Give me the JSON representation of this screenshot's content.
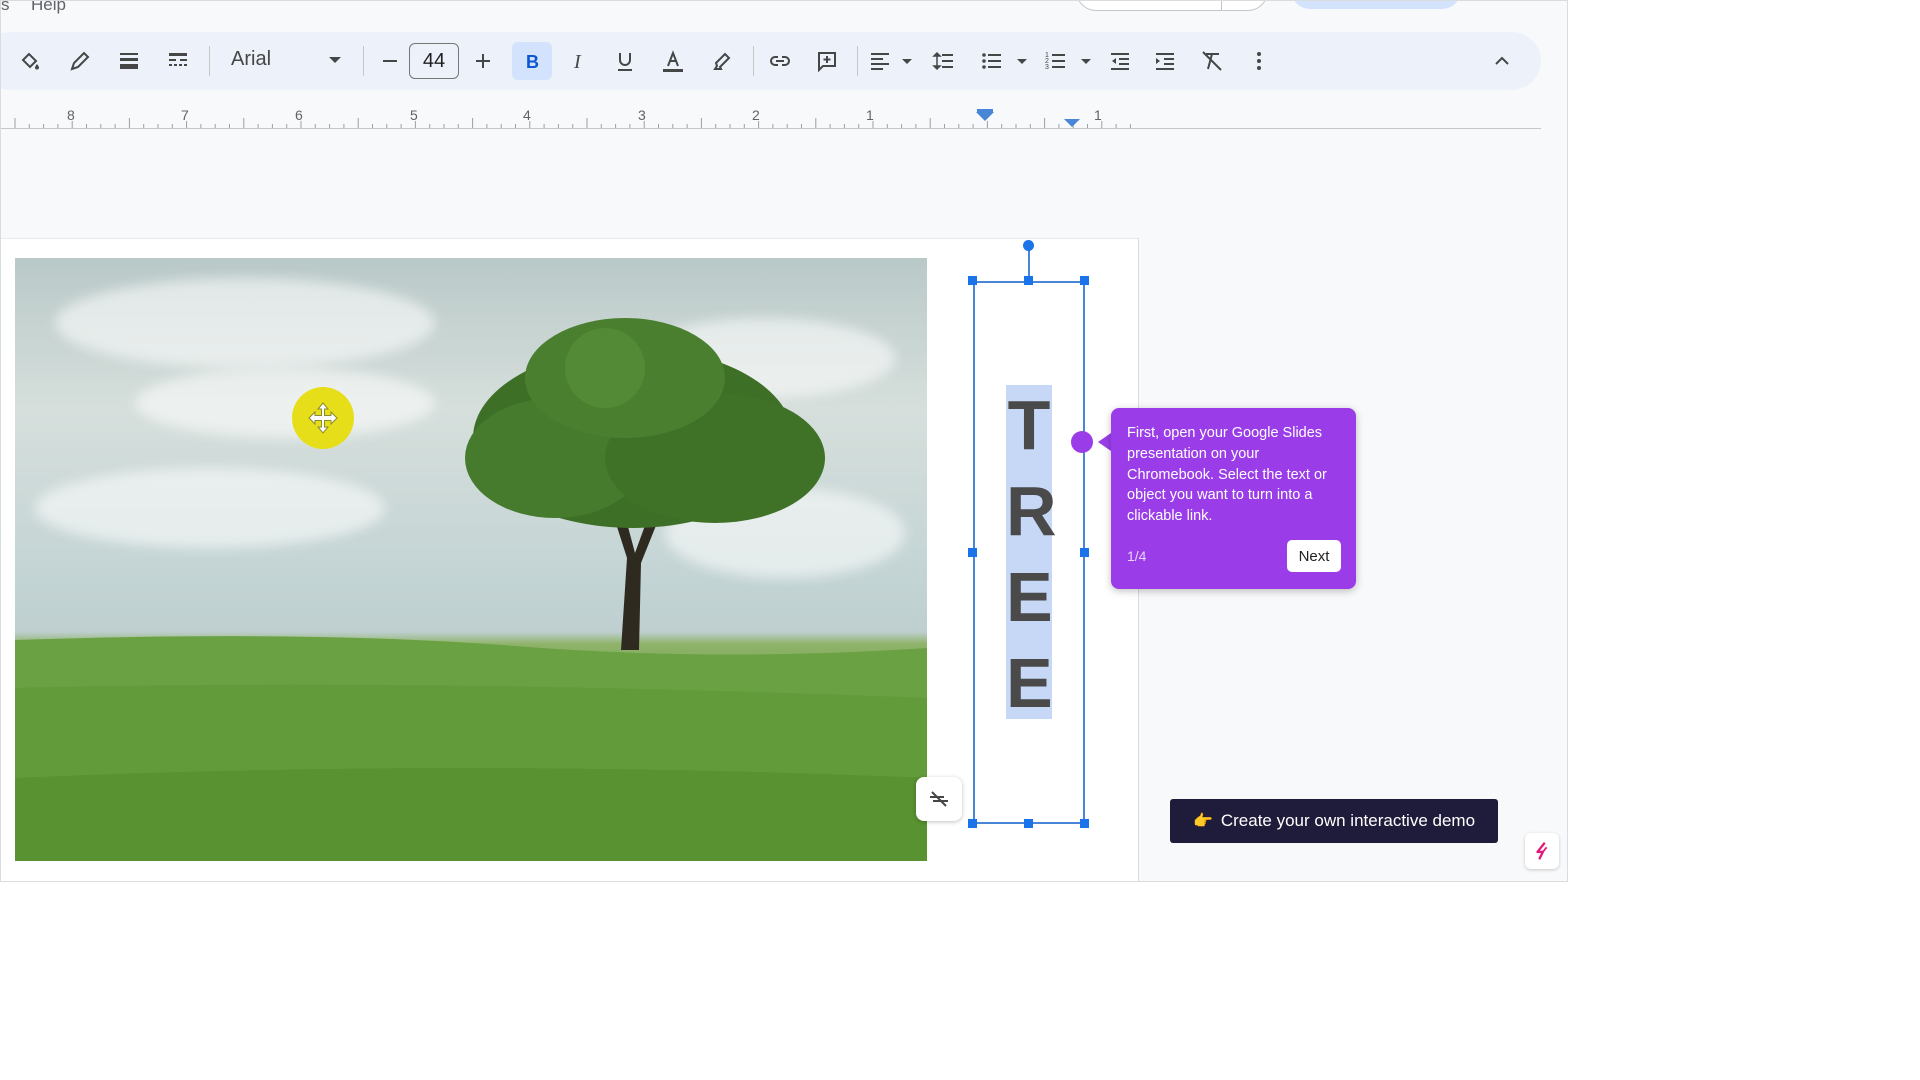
{
  "menu": {
    "help_label": "Help",
    "prev_fragment": "s"
  },
  "toolbar": {
    "font_name": "Arial",
    "font_size": "44",
    "icons": [
      "paint-format-icon",
      "border-color-icon",
      "border-weight-icon",
      "border-dash-icon",
      "decrease-size-icon",
      "increase-size-icon",
      "bold-icon",
      "italic-icon",
      "underline-icon",
      "text-color-icon",
      "highlight-icon",
      "link-icon",
      "comment-icon",
      "align-icon",
      "line-spacing-icon",
      "bulleted-list-icon",
      "numbered-list-icon",
      "decrease-indent-icon",
      "increase-indent-icon",
      "clear-format-icon",
      "more-icon",
      "collapse-icon"
    ]
  },
  "ruler": {
    "labels": [
      "8",
      "7",
      "6",
      "5",
      "4",
      "3",
      "2",
      "1",
      "1"
    ]
  },
  "slide": {
    "letters": [
      "T",
      "R",
      "E",
      "E"
    ]
  },
  "tooltip": {
    "text": "First, open your Google Slides presentation on your Chromebook. Select the text or object you want to turn into a clickable link.",
    "step": "1/4",
    "next_label": "Next",
    "color": "#9a3de8"
  },
  "cta": {
    "hand": "👉",
    "label": "Create your own interactive demo",
    "color": "#1f1b3a"
  },
  "colors": {
    "selection": "#1a73e8",
    "bold_active": "#d3e3fd",
    "toolbar_bg": "#edf2fa"
  }
}
